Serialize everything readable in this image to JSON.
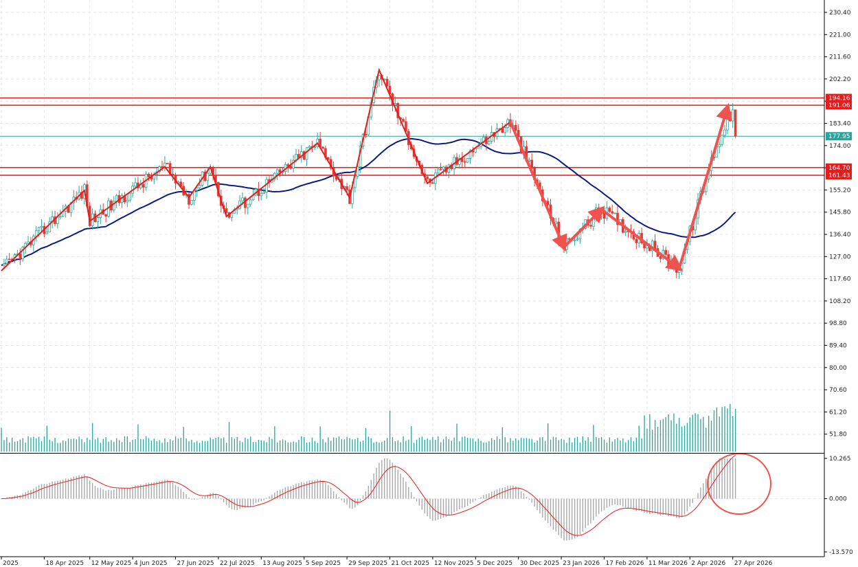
{
  "chart_data": {
    "type": "candlestick",
    "price_axis": {
      "ticks": [
        "230.40",
        "221.00",
        "211.60",
        "202.20",
        "192.80",
        "183.40",
        "174.00",
        "164.60",
        "155.20",
        "145.80",
        "136.40",
        "127.00",
        "117.60",
        "108.20",
        "98.80",
        "89.40",
        "80.00",
        "70.60",
        "61.20",
        "51.80"
      ],
      "range": [
        42.0,
        235.0
      ]
    },
    "time_axis": {
      "labels": [
        "2025",
        "18 Apr 2025",
        "12 May 2025",
        "4 Jun 2025",
        "27 Jun 2025",
        "22 Jul 2025",
        "13 Aug 2025",
        "5 Sep 2025",
        "29 Sep 2025",
        "21 Oct 2025",
        "12 Nov 2025",
        "5 Dec 2025",
        "30 Dec 2025",
        "23 Jan 2026",
        "17 Feb 2026",
        "11 Mar 2026",
        "2 Apr 2026",
        "27 Apr 2026"
      ],
      "label_bars": [
        0,
        16,
        33,
        49,
        65,
        81,
        97,
        113,
        129,
        145,
        161,
        177,
        193,
        209,
        225,
        241,
        257,
        273
      ]
    },
    "horizontal_levels": [
      {
        "value": 194.16,
        "label": "194.16",
        "color": "#e41c1c"
      },
      {
        "value": 191.06,
        "label": "191.06",
        "color": "#e41c1c"
      },
      {
        "value": 177.95,
        "label": "177.95",
        "color": "#26a69a"
      },
      {
        "value": 164.7,
        "label": "164.70",
        "color": "#e41c1c"
      },
      {
        "value": 161.43,
        "label": "161.43",
        "color": "#e41c1c"
      }
    ],
    "zigzag": [
      {
        "bar": 0,
        "price": 121.0
      },
      {
        "bar": 31,
        "price": 155.0
      },
      {
        "bar": 33,
        "price": 142.0
      },
      {
        "bar": 61,
        "price": 165.0
      },
      {
        "bar": 70,
        "price": 152.0
      },
      {
        "bar": 78,
        "price": 165.0
      },
      {
        "bar": 84,
        "price": 144.0
      },
      {
        "bar": 118,
        "price": 175.0
      },
      {
        "bar": 130,
        "price": 152.0
      },
      {
        "bar": 141,
        "price": 206.0
      },
      {
        "bar": 159,
        "price": 158.0
      },
      {
        "bar": 190,
        "price": 184.0
      }
    ],
    "arrows": [
      {
        "from": {
          "bar": 190,
          "price": 184.0
        },
        "to": {
          "bar": 210,
          "price": 131.0
        }
      },
      {
        "from": {
          "bar": 210,
          "price": 131.0
        },
        "to": {
          "bar": 224,
          "price": 147.0
        }
      },
      {
        "from": {
          "bar": 224,
          "price": 147.0
        },
        "to": {
          "bar": 253,
          "price": 122.0
        }
      },
      {
        "from": {
          "bar": 253,
          "price": 122.0
        },
        "to": {
          "bar": 271,
          "price": 190.0
        }
      }
    ],
    "volume": {
      "range": [
        0,
        100
      ]
    },
    "oscillator": {
      "ticks": [
        "10.265",
        "0.000",
        "-13.570"
      ],
      "range": [
        -13.57,
        10.265
      ]
    },
    "colors": {
      "up": "#26a69a",
      "down": "#e53935",
      "ma": "#0d1b7e",
      "zigzag": "#e41c1c",
      "arrow": "#ef5350",
      "level": "#e41c1c",
      "current_price": "#26a69a",
      "volume": "#26a69a",
      "histogram": "#a8a8a8",
      "signal": "#e41c1c",
      "circle": "#ef5350",
      "grid": "#e4e4e4"
    }
  }
}
